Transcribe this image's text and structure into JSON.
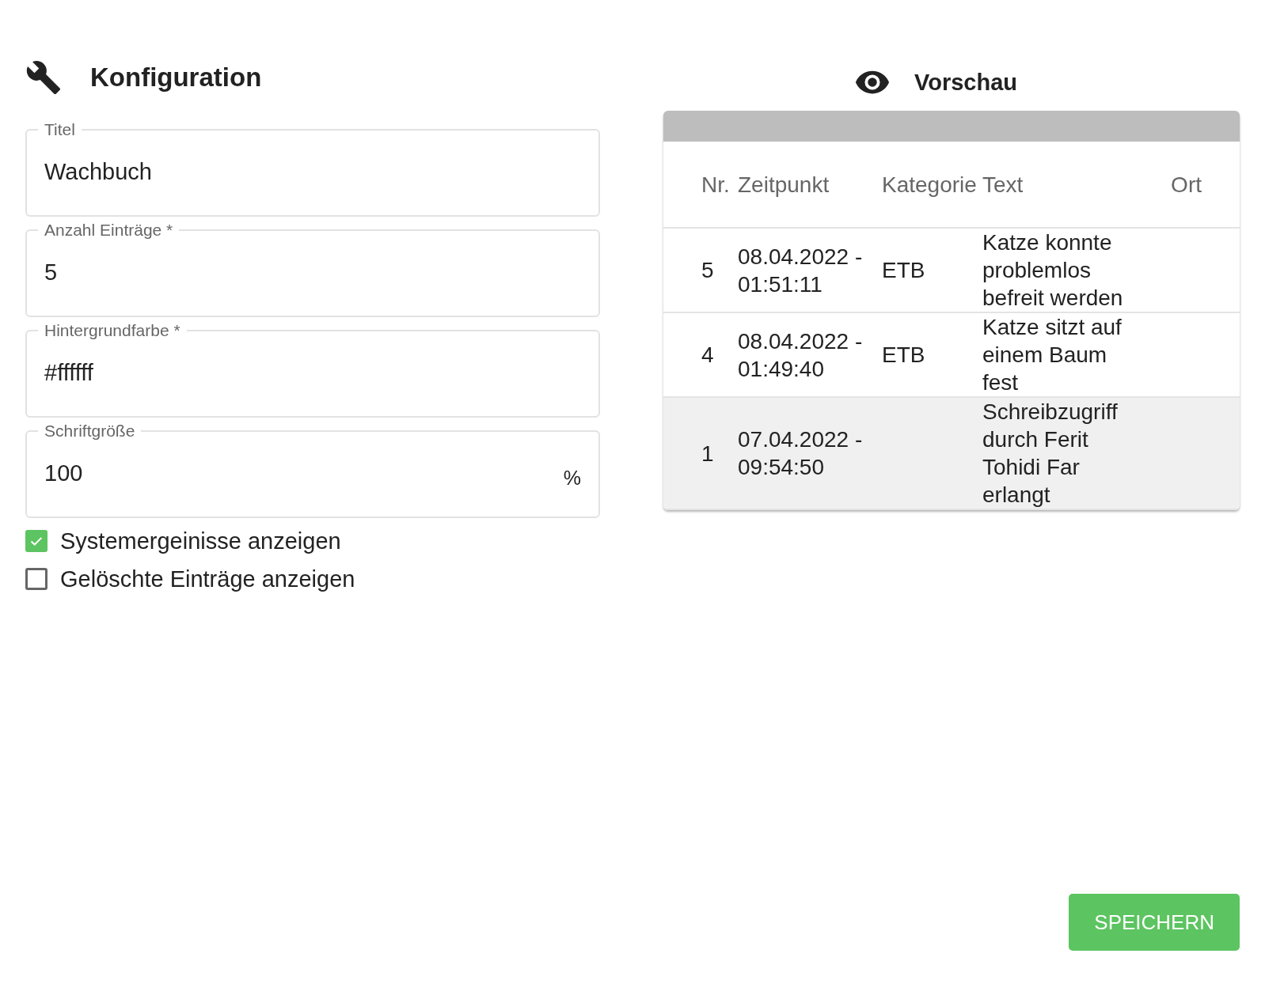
{
  "config": {
    "title": "Konfiguration",
    "fields": [
      {
        "label": "Titel",
        "value": "Wachbuch"
      },
      {
        "label": "Anzahl Einträge *",
        "value": "5"
      },
      {
        "label": "Hintergrundfarbe *",
        "value": "#ffffff"
      },
      {
        "label": "Schriftgröße",
        "value": "100",
        "suffix": "%"
      }
    ],
    "checkboxes": [
      {
        "label": "Systemergeinisse anzeigen",
        "checked": true
      },
      {
        "label": "Gelöschte Einträge anzeigen",
        "checked": false
      }
    ]
  },
  "preview": {
    "title": "Vorschau",
    "columns": [
      "Nr.",
      "Zeitpunkt",
      "Kategorie",
      "Text",
      "Ort"
    ],
    "rows": [
      {
        "kind": "entry",
        "cells": [
          "5",
          "08.04.2022 - 01:51:11",
          "ETB",
          "Katze konnte problemlos befreit werden",
          ""
        ]
      },
      {
        "kind": "entry",
        "cells": [
          "4",
          "08.04.2022 - 01:49:40",
          "ETB",
          "Katze sitzt auf einem Baum fest",
          ""
        ]
      },
      {
        "kind": "system",
        "cells": [
          "1",
          "07.04.2022 - 09:54:50",
          "",
          "Schreibzugriff durch Ferit Tohidi Far erlangt",
          ""
        ]
      }
    ]
  },
  "save_button": "SPEICHERN"
}
